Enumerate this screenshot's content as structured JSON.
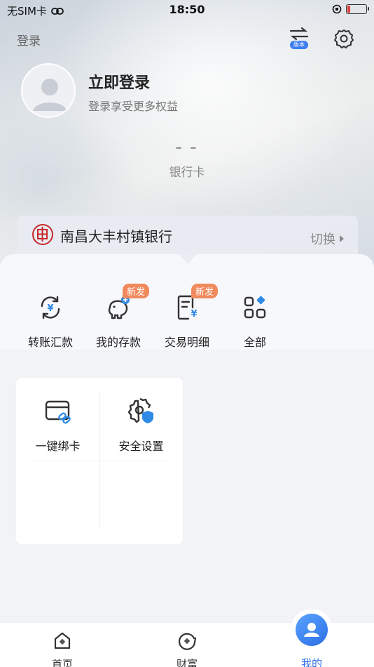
{
  "status_bar": {
    "carrier": "无SIM卡",
    "time": "18:50"
  },
  "header": {
    "login_link": "登录",
    "version_badge": "版本"
  },
  "profile": {
    "title": "立即登录",
    "subtitle": "登录享受更多权益"
  },
  "card": {
    "number": "– –",
    "label": "银行卡"
  },
  "bank": {
    "name": "南昌大丰村镇银行",
    "switch_label": "切换"
  },
  "quick_actions": [
    {
      "label": "转账汇款",
      "badge": ""
    },
    {
      "label": "我的存款",
      "badge": "新发"
    },
    {
      "label": "交易明细",
      "badge": "新发"
    },
    {
      "label": "全部",
      "badge": ""
    }
  ],
  "services": [
    {
      "label": "一键绑卡"
    },
    {
      "label": "安全设置"
    }
  ],
  "tabbar": [
    {
      "label": "首页"
    },
    {
      "label": "财富"
    },
    {
      "label": "我的"
    }
  ],
  "colors": {
    "accent": "#2f6fe8",
    "badge": "#f08a5d",
    "bank_red": "#c8282b"
  }
}
